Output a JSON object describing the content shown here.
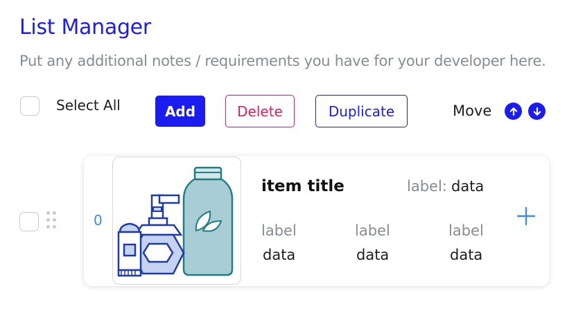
{
  "header": {
    "title": "List Manager",
    "notes": "Put any additional notes / requirements you have for your developer here."
  },
  "toolbar": {
    "select_all_label": "Select All",
    "select_all_checked": false,
    "add_label": "Add",
    "delete_label": "Delete",
    "duplicate_label": "Duplicate",
    "move_label": "Move",
    "move_up_icon": "arrow-up-icon",
    "move_down_icon": "arrow-down-icon"
  },
  "items": [
    {
      "index": "0",
      "checked": false,
      "image": "toiletries-illustration",
      "title": "item title",
      "top_field": {
        "label": "label:",
        "value": "data"
      },
      "fields": [
        {
          "label": "label",
          "value": "data"
        },
        {
          "label": "label",
          "value": "data"
        },
        {
          "label": "label",
          "value": "data"
        }
      ],
      "expand_icon": "plus-icon"
    }
  ],
  "colors": {
    "primary": "#1a1cf0",
    "danger": "#e11d5a",
    "muted_text": "#858c93",
    "index_text": "#3d8fd8",
    "illustration_blue": "#1e3aa8",
    "illustration_teal": "#1f7f86"
  }
}
